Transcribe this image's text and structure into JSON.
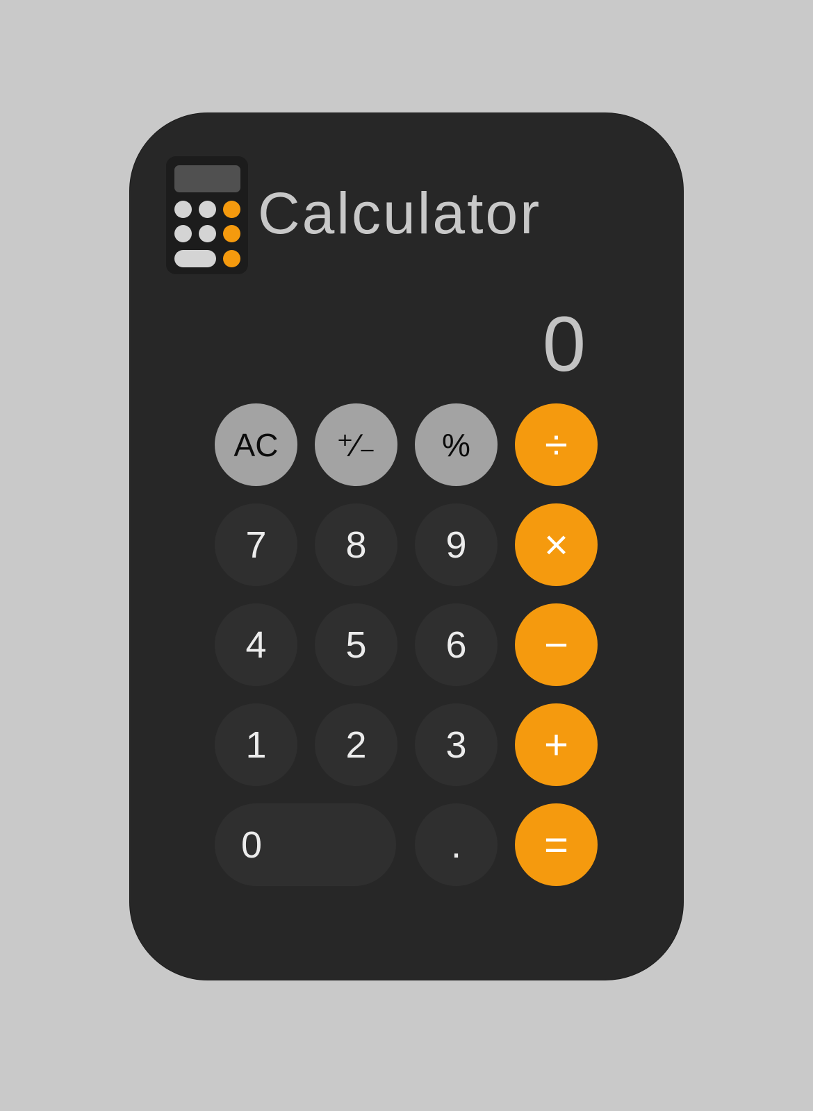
{
  "app": {
    "title": "Calculator",
    "icon": "calculator-app-icon"
  },
  "display": {
    "value": "0"
  },
  "colors": {
    "background": "#c9c9c9",
    "card": "#272727",
    "digit_key": "#2f2f2f",
    "function_key": "#a3a3a3",
    "operator_key": "#f59a0e"
  },
  "keys": {
    "ac": "AC",
    "plus_minus": "⁺∕₋",
    "percent": "%",
    "divide": "÷",
    "seven": "7",
    "eight": "8",
    "nine": "9",
    "multiply": "×",
    "four": "4",
    "five": "5",
    "six": "6",
    "minus": "−",
    "one": "1",
    "two": "2",
    "three": "3",
    "plus": "+",
    "zero": "0",
    "decimal": ".",
    "equals": "="
  }
}
